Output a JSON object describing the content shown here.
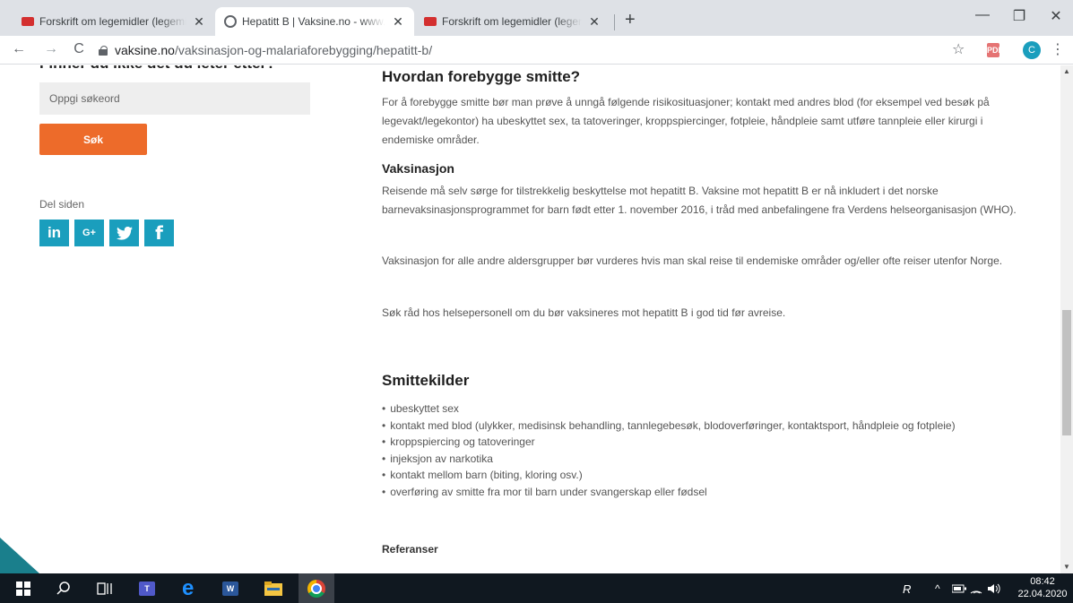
{
  "browser": {
    "tabs": [
      {
        "title": "Forskrift om legemidler (legemid",
        "active": false
      },
      {
        "title": "Hepatitt B | Vaksine.no - www.vak",
        "active": true
      },
      {
        "title": "Forskrift om legemidler (legemid",
        "active": false
      }
    ],
    "tab_close_glyph": "✕",
    "new_tab_glyph": "+",
    "url_host": "vaksine.no",
    "url_path": "/vaksinasjon-og-malariaforebygging/hepatitt-b/",
    "profile_initial": "C",
    "extension_label": "PDF",
    "window_controls": {
      "minimize": "—",
      "maximize": "❐",
      "close": "✕"
    },
    "nav": {
      "back": "←",
      "forward": "→",
      "reload": "C"
    },
    "star": "☆",
    "menu": "⋮"
  },
  "sidebar": {
    "heading": "Finner du ikke det du leter etter?",
    "search_placeholder": "Oppgi søkeord",
    "search_button": "Søk",
    "share_label": "Del siden",
    "share_buttons": [
      {
        "icon": "linkedin-icon",
        "glyph": "in"
      },
      {
        "icon": "google-plus-icon",
        "glyph": "G+"
      },
      {
        "icon": "twitter-icon",
        "glyph": "🐦"
      },
      {
        "icon": "facebook-icon",
        "glyph": "f"
      }
    ],
    "accent_color": "#1a9ebd",
    "button_color": "#ed6b2a"
  },
  "main": {
    "prevent_heading": "Hvordan forebygge smitte?",
    "prevent_text": "For å forebygge smitte bør man prøve å unngå følgende risikosituasjoner; kontakt med andres blod (for eksempel ved besøk på legevakt/legekontor) ha ubeskyttet sex, ta tatoveringer, kroppspiercinger, fotpleie, håndpleie samt utføre tannpleie eller kirurgi i endemiske områder.",
    "vaccination_heading": "Vaksinasjon",
    "vaccination_p1": "Reisende må selv sørge for tilstrekkelig beskyttelse mot hepatitt B. Vaksine mot hepatitt B er nå inkludert i det norske barnevaksinasjonsprogrammet for barn født etter 1. november 2016, i tråd med anbefalingene fra Verdens helseorganisasjon (WHO).",
    "vaccination_p2": "Vaksinasjon for alle andre aldersgrupper bør vurderes hvis man skal reise til endemiske områder og/eller ofte reiser utenfor Norge.",
    "vaccination_p3": "Søk råd hos helsepersonell om du bør vaksineres mot hepatitt B i god tid før avreise.",
    "sources_heading": "Smittekilder",
    "sources": [
      "ubeskyttet sex",
      "kontakt med blod (ulykker, medisinsk behandling, tannlegebesøk, blodoverføringer, kontaktsport, håndpleie og fotpleie)",
      "kroppspiercing og tatoveringer",
      "injeksjon av narkotika",
      "kontakt mellom barn (biting, kloring osv.)",
      "overføring av smitte fra mor til barn under svangerskap eller fødsel"
    ],
    "references_heading": "Referanser"
  },
  "taskbar": {
    "time": "08:42",
    "date": "22.04.2020",
    "word_label": "W",
    "teams_label": "T",
    "edge_label": "e",
    "keyboard_label": "R"
  }
}
